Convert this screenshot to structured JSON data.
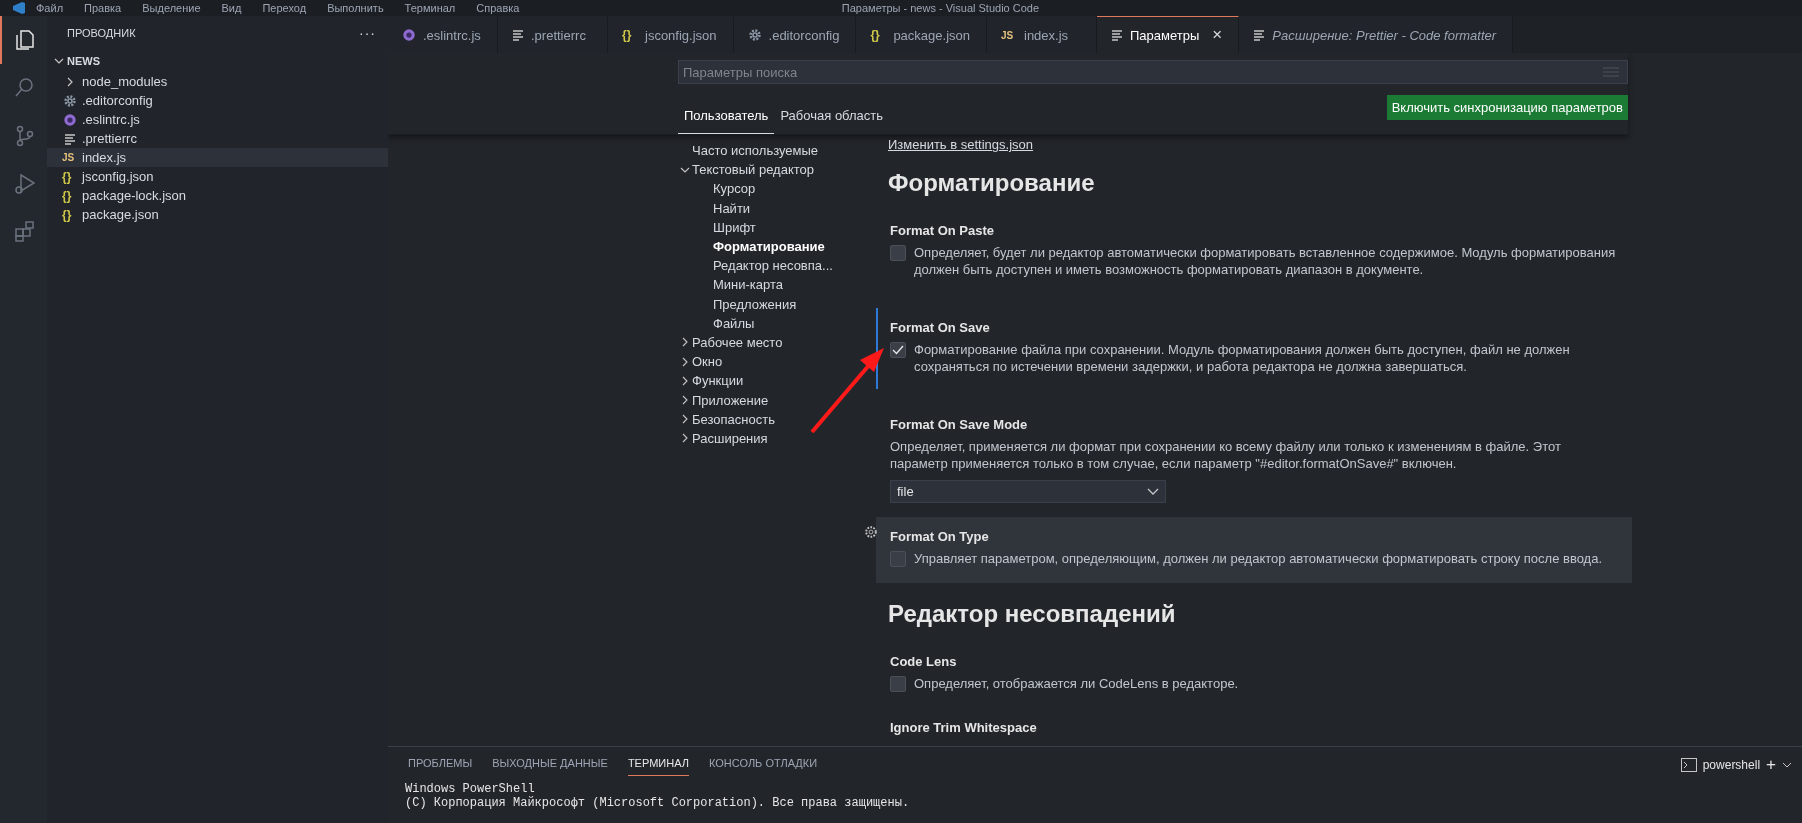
{
  "title_bar": {
    "menu": [
      "Файл",
      "Правка",
      "Выделение",
      "Вид",
      "Переход",
      "Выполнить",
      "Терминал",
      "Справка"
    ],
    "title": "Параметры - news - Visual Studio Code"
  },
  "activity_bar": {
    "items": [
      {
        "kind": "files",
        "selected": true
      },
      {
        "kind": "search",
        "selected": false
      },
      {
        "kind": "source-control",
        "selected": false
      },
      {
        "kind": "run",
        "selected": false
      },
      {
        "kind": "extensions",
        "selected": false
      }
    ]
  },
  "explorer": {
    "title": "ПРОВОДНИК",
    "more": "···",
    "root": {
      "label": "NEWS",
      "expanded": true,
      "children": [
        {
          "label": "node_modules",
          "kind": "folder",
          "expanded": false,
          "selected": false
        },
        {
          "label": ".editorconfig",
          "kind": "gear",
          "selected": false
        },
        {
          "label": ".eslintrc.js",
          "kind": "eslint",
          "selected": false
        },
        {
          "label": ".prettierrc",
          "kind": "lines",
          "selected": false
        },
        {
          "label": "index.js",
          "kind": "js",
          "glyph": "JS",
          "selected": true
        },
        {
          "label": "jsconfig.json",
          "kind": "json",
          "glyph": "{}",
          "selected": false
        },
        {
          "label": "package-lock.json",
          "kind": "json",
          "glyph": "{}",
          "selected": false
        },
        {
          "label": "package.json",
          "kind": "json",
          "glyph": "{}",
          "selected": false
        }
      ]
    }
  },
  "tabs": [
    {
      "label": ".eslintrc.js",
      "kind": "eslint",
      "selected": false,
      "preview": false
    },
    {
      "label": ".prettierrc",
      "kind": "lines",
      "selected": false,
      "preview": false
    },
    {
      "label": "jsconfig.json",
      "kind": "json",
      "glyph": "{}",
      "selected": false,
      "preview": false
    },
    {
      "label": ".editorconfig",
      "kind": "gear",
      "selected": false,
      "preview": false
    },
    {
      "label": "package.json",
      "kind": "json",
      "glyph": "{}",
      "selected": false,
      "preview": false
    },
    {
      "label": "index.js",
      "kind": "js",
      "glyph": "JS",
      "selected": false,
      "preview": false
    },
    {
      "label": "Параметры",
      "kind": "lines",
      "selected": true,
      "preview": false,
      "close": "×"
    },
    {
      "label": "Расширение: Prettier - Code formatter",
      "kind": "lines",
      "selected": false,
      "preview": true
    }
  ],
  "settings": {
    "search": {
      "placeholder": "Параметры поиска"
    },
    "scopes": [
      {
        "label": "Пользователь",
        "selected": true
      },
      {
        "label": "Рабочая область",
        "selected": false
      }
    ],
    "sync_button": "Включить синхронизацию параметров",
    "toc": [
      {
        "label": "Часто используемые",
        "selected": false
      },
      {
        "label": "Текстовый редактор",
        "expanded": true,
        "selected": false,
        "children": [
          {
            "label": "Курсор",
            "selected": false
          },
          {
            "label": "Найти",
            "selected": false
          },
          {
            "label": "Шрифт",
            "selected": false
          },
          {
            "label": "Форматирование",
            "selected": true
          },
          {
            "label": "Редактор несовпа...",
            "selected": false
          },
          {
            "label": "Мини-карта",
            "selected": false
          },
          {
            "label": "Предложения",
            "selected": false
          },
          {
            "label": "Файлы",
            "selected": false
          }
        ]
      },
      {
        "label": "Рабочее место",
        "expanded": false,
        "selected": false
      },
      {
        "label": "Окно",
        "expanded": false,
        "selected": false
      },
      {
        "label": "Функции",
        "expanded": false,
        "selected": false
      },
      {
        "label": "Приложение",
        "expanded": false,
        "selected": false
      },
      {
        "label": "Безопасность",
        "expanded": false,
        "selected": false
      },
      {
        "label": "Расширения",
        "expanded": false,
        "selected": false
      }
    ],
    "edit_link": "Изменить в settings.json",
    "sections": [
      {
        "title": "Форматирование",
        "items": [
          {
            "title": "Format On Paste",
            "kind": "checkbox",
            "checked": false,
            "modified": false,
            "focused": false,
            "description": "Определяет, будет ли редактор автоматически форматировать вставленное содержимое. Модуль форматирования должен быть доступен и иметь возможность форматировать диапазон в документе."
          },
          {
            "title": "Format On Save",
            "kind": "checkbox",
            "checked": true,
            "modified": true,
            "focused": false,
            "description": "Форматирование файла при сохранении. Модуль форматирования должен быть доступен, файл не должен сохраняться по истечении времени задержки, и работа редактора не должна завершаться."
          },
          {
            "title": "Format On Save Mode",
            "kind": "select",
            "value": "file",
            "modified": false,
            "focused": false,
            "description": "Определяет, применяется ли формат при сохранении ко всему файлу или только к изменениям в файле. Этот параметр применяется только в том случае, если параметр \"#editor.formatOnSave#\" включен."
          },
          {
            "title": "Format On Type",
            "kind": "checkbox",
            "checked": false,
            "modified": false,
            "focused": true,
            "description": "Управляет параметром, определяющим, должен ли редактор автоматически форматировать строку после ввода."
          }
        ]
      },
      {
        "title": "Редактор несовпадений",
        "items": [
          {
            "title": "Code Lens",
            "kind": "checkbox",
            "checked": false,
            "modified": false,
            "focused": false,
            "description": "Определяет, отображается ли CodeLens в редакторе."
          },
          {
            "title": "Ignore Trim Whitespace",
            "kind": "title",
            "modified": false,
            "focused": false
          }
        ]
      }
    ]
  },
  "panel": {
    "tabs": [
      {
        "label": "ПРОБЛЕМЫ",
        "selected": false
      },
      {
        "label": "ВЫХОДНЫЕ ДАННЫЕ",
        "selected": false
      },
      {
        "label": "ТЕРМИНАЛ",
        "selected": true
      },
      {
        "label": "КОНСОЛЬ ОТЛАДКИ",
        "selected": false
      }
    ],
    "terminal_name": "powershell",
    "add": "+",
    "lines": [
      "Windows PowerShell",
      "(C) Корпорация Майкрософт (Microsoft Corporation). Все права защищены."
    ]
  }
}
